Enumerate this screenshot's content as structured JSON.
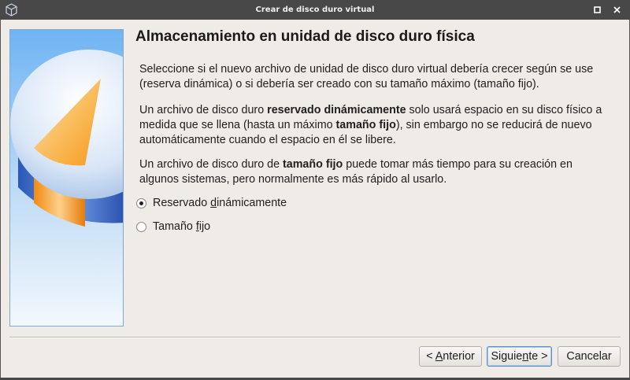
{
  "window": {
    "title": "Crear de disco duro virtual"
  },
  "page": {
    "heading": "Almacenamiento en unidad de disco duro física",
    "para1": "Seleccione si el nuevo archivo de unidad de disco duro virtual debería crecer según se use (reserva dinámica) o si debería ser creado con su tamaño máximo (tamaño fijo).",
    "para2": {
      "t1": "Un archivo de disco duro ",
      "b1": "reservado dinámicamente",
      "t2": " solo usará espacio en su disco físico a medida que se llena (hasta un máximo ",
      "b2": "tamaño fijo",
      "t3": "), sin embargo no se reducirá de nuevo automáticamente cuando el espacio en él se libere."
    },
    "para3": {
      "t1": "Un archivo de disco duro de ",
      "b1": "tamaño fijo",
      "t2": " puede tomar más tiempo para su creación en algunos sistemas, pero normalmente es más rápido al usarlo."
    }
  },
  "options": [
    {
      "pre": "Reservado ",
      "mnemonic": "d",
      "post": "inámicamente",
      "selected": true
    },
    {
      "pre": "Tamaño ",
      "mnemonic": "f",
      "post": "ijo",
      "selected": false
    }
  ],
  "buttons": {
    "back": {
      "pre": "< ",
      "mnemonic": "A",
      "post": "nterior"
    },
    "next": {
      "pre": "Siguie",
      "mnemonic": "n",
      "post": "te >"
    },
    "cancel": {
      "label": "Cancelar"
    }
  },
  "colors": {
    "titlebar": "#484848",
    "background": "#efebe7",
    "accent_blue": "#3f7fd0",
    "accent_orange": "#f5a623"
  },
  "icons": {
    "app": "virtualbox-icon",
    "minimize": "minimize-icon",
    "maximize": "maximize-icon",
    "close": "close-icon"
  }
}
